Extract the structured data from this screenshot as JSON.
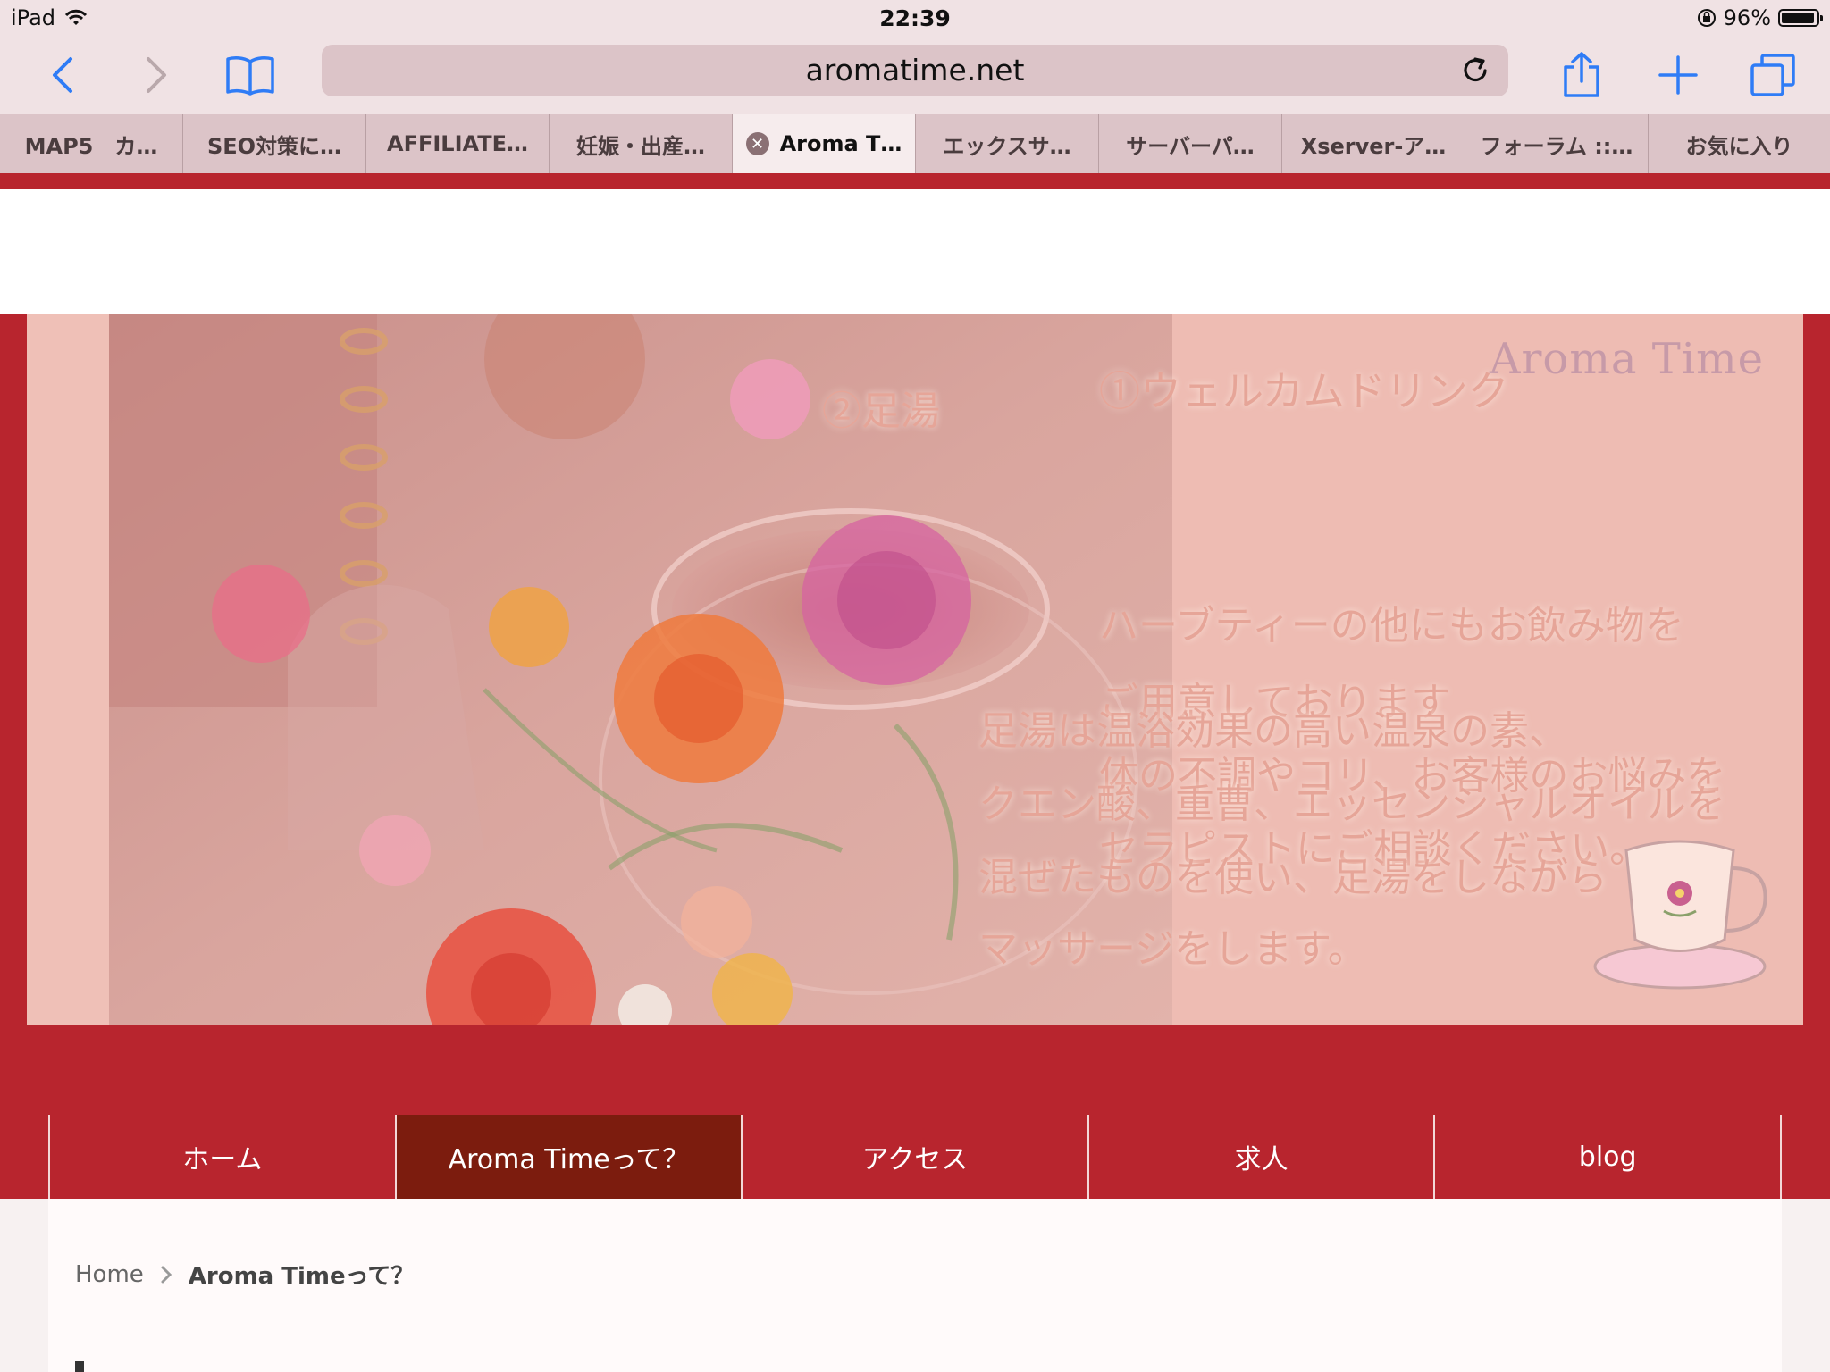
{
  "status_bar": {
    "device": "iPad",
    "time": "22:39",
    "battery": "96%",
    "battery_level": 0.96
  },
  "toolbar": {
    "url": "aromatime.net",
    "accent_color": "#2f7cf6"
  },
  "tabs": [
    {
      "label": "MAP5　カ…",
      "active": false
    },
    {
      "label": "SEO対策に…",
      "active": false
    },
    {
      "label": "AFFILIATE…",
      "active": false
    },
    {
      "label": "妊娠・出産…",
      "active": false
    },
    {
      "label": "Aroma T…",
      "active": true
    },
    {
      "label": "エックスサ…",
      "active": false
    },
    {
      "label": "サーバーパ…",
      "active": false
    },
    {
      "label": "Xserver-ア…",
      "active": false
    },
    {
      "label": "フォーラム ::…",
      "active": false
    },
    {
      "label": "お気に入り",
      "active": false
    }
  ],
  "banner": {
    "logo": "Aroma Time",
    "step1": "①ウェルカムドリンク",
    "step2": "②足湯",
    "drink_lines": [
      "ハーブティーの他にもお飲み物を",
      "ご用意しております",
      "体の不調やコリ、お客様のお悩みを",
      "セラピストにご相談ください。"
    ],
    "footbath_lines": [
      "足湯は温浴効果の高い温泉の素、",
      "クエン酸、重曹、エッセンシャルオイルを",
      "混ぜたものを使い、足湯をしながら",
      "マッサージをします。"
    ]
  },
  "nav": {
    "items": [
      {
        "label": "ホーム",
        "active": false
      },
      {
        "label": "Aroma Timeって？",
        "active": true
      },
      {
        "label": "アクセス",
        "active": false
      },
      {
        "label": "求人",
        "active": false
      },
      {
        "label": "blog",
        "active": false
      }
    ]
  },
  "breadcrumb": {
    "home": "Home",
    "current": "Aroma Timeって？"
  },
  "colors": {
    "brand_red": "#b8252e",
    "nav_active": "#7c1c0e"
  }
}
